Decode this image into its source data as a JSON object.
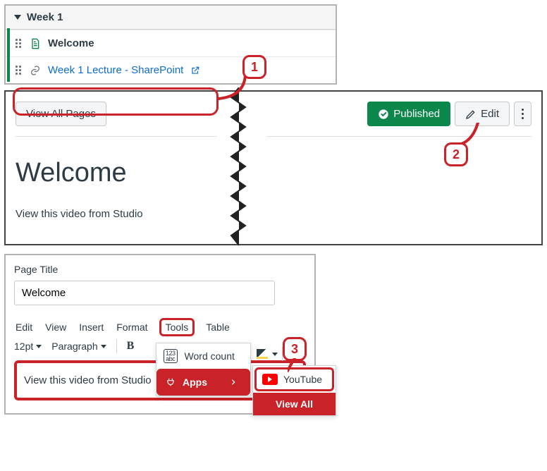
{
  "panel1": {
    "week_title": "Week 1",
    "items": [
      {
        "title": "Welcome",
        "bold": true
      },
      {
        "title": "Week 1 Lecture - SharePoint",
        "link": true
      }
    ]
  },
  "callouts": {
    "one": "1",
    "two": "2",
    "three": "3"
  },
  "panel2": {
    "view_all_pages": "View All Pages",
    "published": "Published",
    "edit": "Edit",
    "title": "Welcome",
    "subtitle": "View this video from Studio"
  },
  "panel3": {
    "page_title_label": "Page Title",
    "page_title_value": "Welcome",
    "menu": {
      "edit": "Edit",
      "view": "View",
      "insert": "Insert",
      "format": "Format",
      "tools": "Tools",
      "table": "Table"
    },
    "toolbar": {
      "font_size": "12pt",
      "paragraph": "Paragraph",
      "bold": "B",
      "word_count": "Word count"
    },
    "dropdown": {
      "apps": "Apps",
      "youtube": "YouTube",
      "view_all": "View All"
    },
    "body_text": "View this video from Studio"
  }
}
